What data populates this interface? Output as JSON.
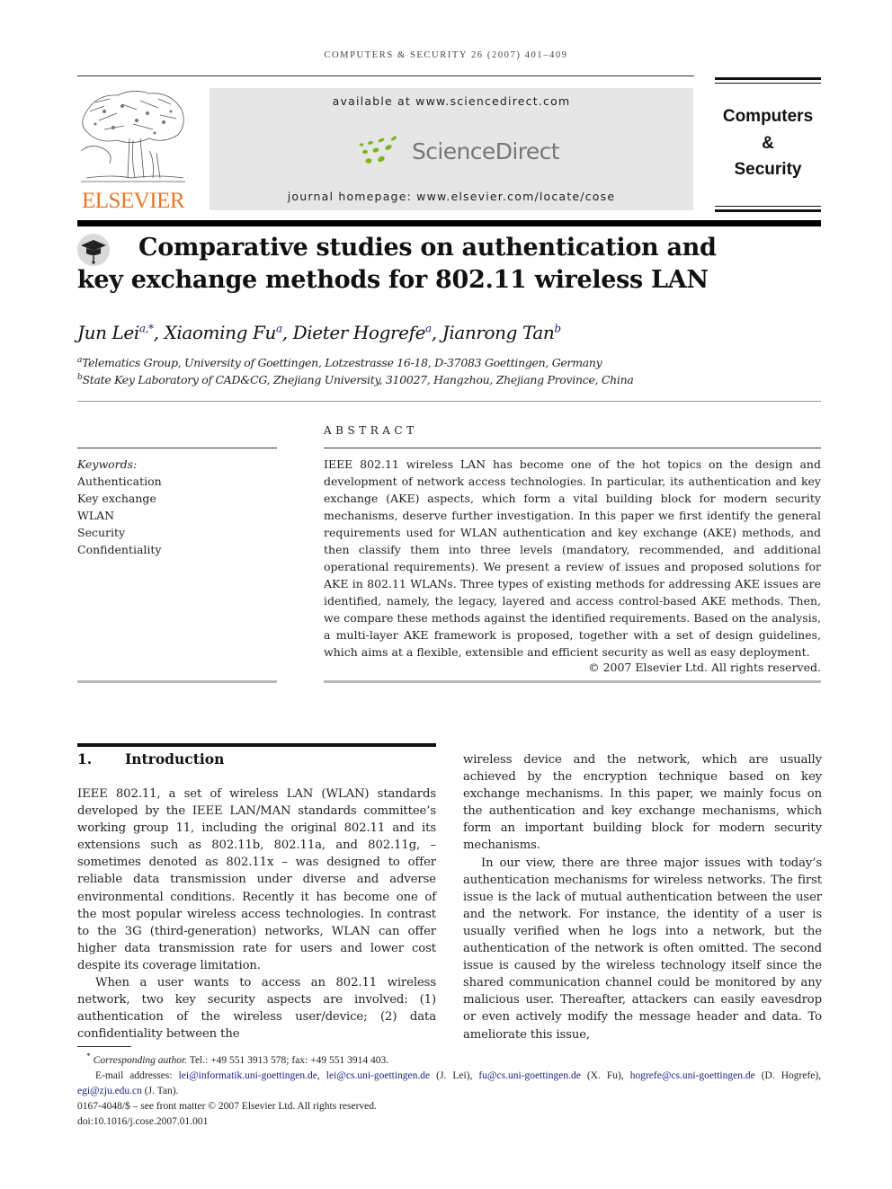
{
  "running_head": "COMPUTERS & SECURITY 26 (2007) 401–409",
  "publisher": {
    "logo_text": "ELSEVIER",
    "logo_color": "#e87722",
    "available_at": "available at www.sciencedirect.com",
    "sciencedirect_brand": "ScienceDirect",
    "sciencedirect_dot_color": "#7cb518",
    "journal_homepage": "journal homepage: www.elsevier.com/locate/cose"
  },
  "journal": {
    "line1": "Computers",
    "line2": "&",
    "line3": "Security"
  },
  "article": {
    "title": "Comparative studies on authentication and key exchange methods for 802.11 wireless LAN",
    "authors": [
      {
        "name": "Jun Lei",
        "affil": "a,*"
      },
      {
        "name": "Xiaoming Fu",
        "affil": "a"
      },
      {
        "name": "Dieter Hogrefe",
        "affil": "a"
      },
      {
        "name": "Jianrong Tan",
        "affil": "b"
      }
    ],
    "affiliations": [
      {
        "mark": "a",
        "text": "Telematics Group, University of Goettingen, Lotzestrasse 16-18, D-37083 Goettingen, Germany"
      },
      {
        "mark": "b",
        "text": "State Key Laboratory of CAD&CG, Zhejiang University, 310027, Hangzhou, Zhejiang Province, China"
      }
    ]
  },
  "keywords": {
    "label": "Keywords:",
    "items": [
      "Authentication",
      "Key exchange",
      "WLAN",
      "Security",
      "Confidentiality"
    ]
  },
  "abstract": {
    "label": "ABSTRACT",
    "text": "IEEE 802.11 wireless LAN has become one of the hot topics on the design and development of network access technologies. In particular, its authentication and key exchange (AKE) aspects, which form a vital building block for modern security mechanisms, deserve further investigation. In this paper we first identify the general requirements used for WLAN authentication and key exchange (AKE) methods, and then classify them into three levels (mandatory, recommended, and additional operational requirements). We present a review of issues and proposed solutions for AKE in 802.11 WLANs. Three types of existing methods for addressing AKE issues are identified, namely, the legacy, layered and access control-based AKE methods. Then, we compare these methods against the identified requirements. Based on the analysis, a multi-layer AKE framework is proposed, together with a set of design guidelines, which aims at a flexible, extensible and efficient security as well as easy deployment.",
    "copyright": "© 2007 Elsevier Ltd. All rights reserved."
  },
  "section1": {
    "number": "1.",
    "title": "Introduction",
    "left_paragraphs": [
      "IEEE 802.11, a set of wireless LAN (WLAN) standards developed by the IEEE LAN/MAN standards committee’s working group 11, including the original 802.11 and its extensions such as 802.11b, 802.11a, and 802.11g, – sometimes denoted as 802.11x – was designed to offer reliable data transmission under diverse and adverse environmental conditions. Recently it has become one of the most popular wireless access technologies. In contrast to the 3G (third-generation) networks, WLAN can offer higher data transmission rate for users and lower cost despite its coverage limitation.",
      "When a user wants to access an 802.11 wireless network, two key security aspects are involved: (1) authentication of the wireless user/device; (2) data confidentiality between the"
    ],
    "right_paragraphs": [
      "wireless device and the network, which are usually achieved by the encryption technique based on key exchange mechanisms. In this paper, we mainly focus on the authentication and key exchange mechanisms, which form an important building block for modern security mechanisms.",
      "In our view, there are three major issues with today’s authentication mechanisms for wireless networks. The first issue is the lack of mutual authentication between the user and the network. For instance, the identity of a user is usually verified when he logs into a network, but the authentication of the network is often omitted. The second issue is caused by the wireless technology itself since the shared communication channel could be monitored by any malicious user. Thereafter, attackers can easily eavesdrop or even actively modify the message header and data. To ameliorate this issue,"
    ]
  },
  "footnotes": {
    "corresponding_mark": "*",
    "corresponding_label": "Corresponding author.",
    "contact": "Tel.: +49 551 3913 578; fax: +49 551 3914 403.",
    "email_label": "E-mail addresses:",
    "emails": [
      {
        "address": "lei@informatik.uni-goettingen.de",
        "owner": ""
      },
      {
        "address": "lei@cs.uni-goettingen.de",
        "owner": "(J. Lei)"
      },
      {
        "address": "fu@cs.uni-goettingen.de",
        "owner": "(X. Fu)"
      },
      {
        "address": "hogrefe@cs.uni-goettingen.de",
        "owner": "(D. Hogrefe)"
      },
      {
        "address": "egi@zju.edu.cn",
        "owner": "(J. Tan)."
      }
    ],
    "front_matter": "0167-4048/$ – see front matter © 2007 Elsevier Ltd. All rights reserved.",
    "doi": "doi:10.1016/j.cose.2007.01.001"
  }
}
